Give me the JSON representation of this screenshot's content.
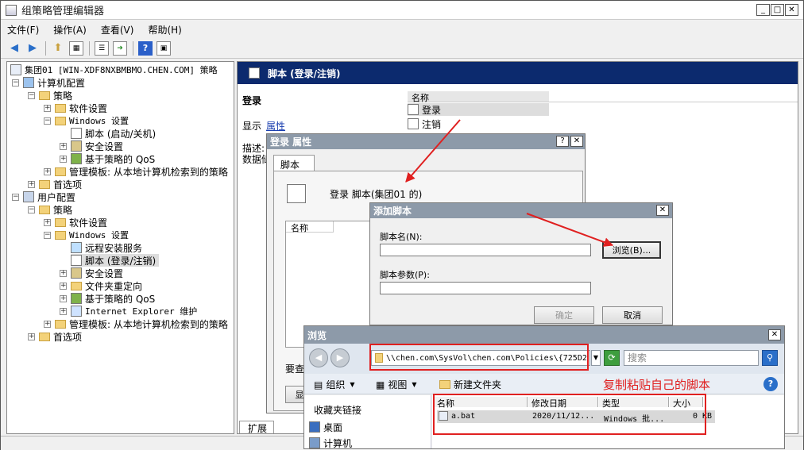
{
  "window": {
    "title": "组策略管理编辑器",
    "controls": [
      "_",
      "□",
      "✕"
    ]
  },
  "menu": [
    "文件(F)",
    "操作(A)",
    "查看(V)",
    "帮助(H)"
  ],
  "tree": {
    "root": "集团01 [WIN-XDF8NXBMBMO.CHEN.COM] 策略",
    "computer_config": "计算机配置",
    "policy1": "策略",
    "software1": "软件设置",
    "windows1": "Windows 设置",
    "script1": "脚本 (启动/关机)",
    "security1": "安全设置",
    "qos1": "基于策略的 QoS",
    "admin1": "管理模板: 从本地计算机检索到的策略",
    "prefs1": "首选项",
    "user_config": "用户配置",
    "policy2": "策略",
    "software2": "软件设置",
    "windows2": "Windows 设置",
    "remote": "远程安装服务",
    "script2": "脚本 (登录/注销)",
    "security2": "安全设置",
    "redirect": "文件夹重定向",
    "qos2": "基于策略的 QoS",
    "ie": "Internet Explorer 维护",
    "admin2": "管理模板: 从本地计算机检索到的策略",
    "prefs2": "首选项"
  },
  "right": {
    "header": "脚本 (登录/注销)",
    "logon": "登录",
    "show_label": "显示",
    "properties_link": "属性",
    "desc_label": "描述:",
    "data_label": "数据储",
    "list_header": "名称",
    "list_items": [
      "登录",
      "注销"
    ],
    "bottom_tab": "扩展"
  },
  "logon_dialog": {
    "title": "登录 属性",
    "tab": "脚本",
    "caption": "登录 脚本(集团01 的)",
    "list_header": "名称",
    "partial_label": "要查",
    "partial_btn": "显"
  },
  "add_dialog": {
    "title": "添加脚本",
    "name_label": "脚本名(N):",
    "browse_btn": "浏览(B)...",
    "params_label": "脚本参数(P):",
    "ok_btn": "确定",
    "cancel_btn": "取消"
  },
  "browse_dialog": {
    "title": "浏览",
    "path": "\\\\chen.com\\SysVol\\chen.com\\Policies\\{725D2",
    "search_placeholder": "搜索",
    "organize": "组织",
    "views": "视图",
    "new_folder": "新建文件夹",
    "favorites": "收藏夹链接",
    "desktop": "桌面",
    "computer": "计算机",
    "cols": [
      "名称",
      "修改日期",
      "类型",
      "大小"
    ],
    "file": {
      "name": "a.bat",
      "date": "2020/11/12...",
      "type": "Windows 批...",
      "size": "0 KB"
    }
  },
  "annotation": "复制粘贴自己的脚本",
  "colors": {
    "header_blue": "#0c2a6e",
    "dialog_title": "#8d9aa9",
    "annotation_red": "#e02020"
  }
}
